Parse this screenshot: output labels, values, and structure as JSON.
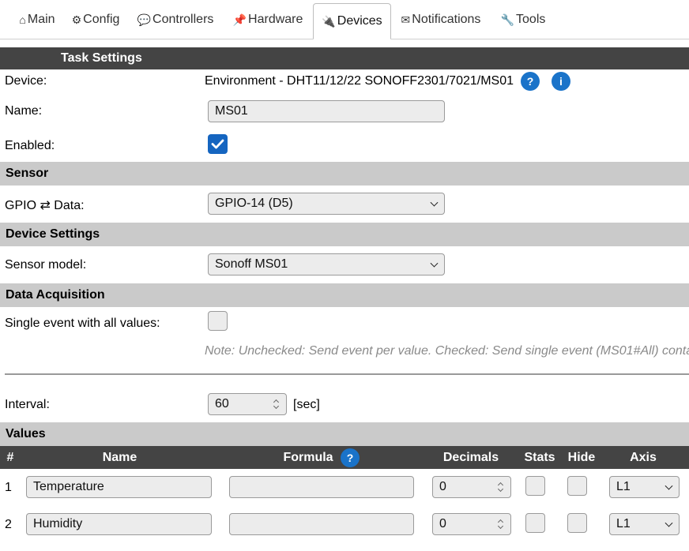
{
  "tabs": [
    {
      "label": "Main",
      "icon": "home-icon",
      "glyph": "⌂"
    },
    {
      "label": "Config",
      "icon": "gear-icon",
      "glyph": "⚙"
    },
    {
      "label": "Controllers",
      "icon": "chat-icon",
      "glyph": "💬"
    },
    {
      "label": "Hardware",
      "icon": "pushpin-icon",
      "glyph": "📌"
    },
    {
      "label": "Devices",
      "icon": "plug-icon",
      "glyph": "🔌",
      "active": true
    },
    {
      "label": "Notifications",
      "icon": "envelope-icon",
      "glyph": "✉"
    },
    {
      "label": "Tools",
      "icon": "wrench-icon",
      "glyph": "🔧"
    }
  ],
  "task_settings": {
    "title": "Task Settings",
    "device_label": "Device:",
    "device_value": "Environment - DHT11/12/22 SONOFF2301/7021/MS01",
    "help_q": "?",
    "help_i": "i",
    "name_label": "Name:",
    "name_value": "MS01",
    "enabled_label": "Enabled:",
    "enabled": true
  },
  "sensor": {
    "title": "Sensor",
    "gpio_label": "GPIO ⇄ Data:",
    "gpio_value": "GPIO-14 (D5)"
  },
  "device_settings": {
    "title": "Device Settings",
    "model_label": "Sensor model:",
    "model_value": "Sonoff MS01"
  },
  "data_acquisition": {
    "title": "Data Acquisition",
    "single_event_label": "Single event with all values:",
    "single_event": false,
    "note": "Note: Unchecked: Send event per value. Checked: Send single event (MS01#All) conta",
    "interval_label": "Interval:",
    "interval_value": "60",
    "interval_unit": "[sec]"
  },
  "values": {
    "title": "Values",
    "columns": {
      "num": "#",
      "name": "Name",
      "formula": "Formula",
      "formula_help": "?",
      "decimals": "Decimals",
      "stats": "Stats",
      "hide": "Hide",
      "axis": "Axis"
    },
    "rows": [
      {
        "num": "1",
        "name": "Temperature",
        "formula": "",
        "decimals": "0",
        "stats": false,
        "hide": false,
        "axis": "L1"
      },
      {
        "num": "2",
        "name": "Humidity",
        "formula": "",
        "decimals": "0",
        "stats": false,
        "hide": false,
        "axis": "L1"
      }
    ]
  },
  "colors": {
    "header_dark": "#444444",
    "header_grey": "#cacaca",
    "accent": "#1565c0"
  }
}
